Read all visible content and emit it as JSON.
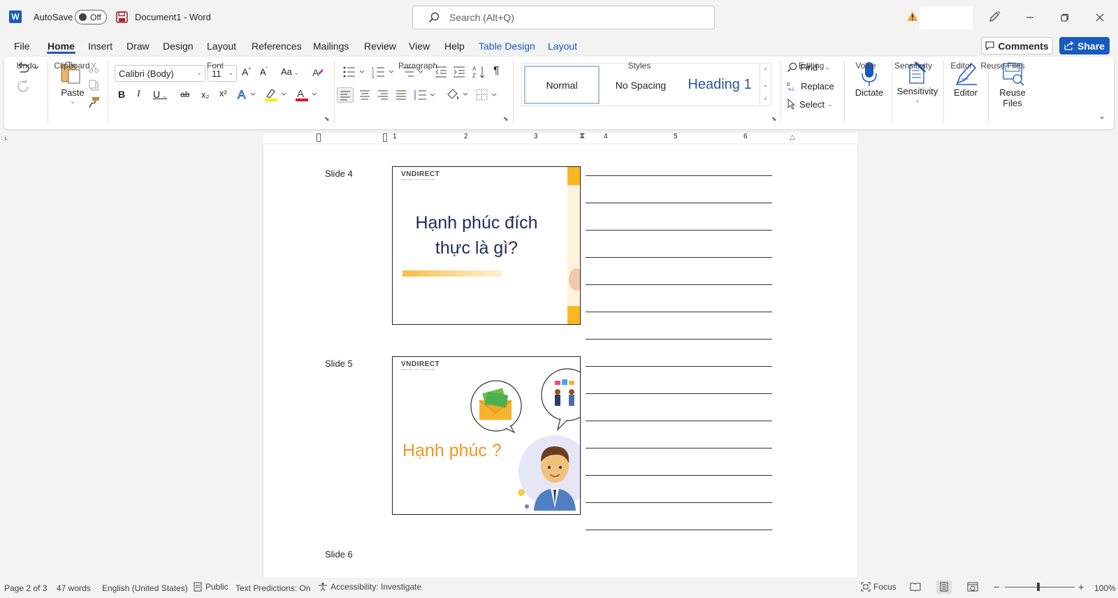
{
  "titlebar": {
    "app_icon_letter": "W",
    "autosave_label": "AutoSave",
    "autosave_state": "Off",
    "doc_title": "Document1  -  Word",
    "search_placeholder": "Search (Alt+Q)"
  },
  "menu": {
    "tabs": [
      "File",
      "Home",
      "Insert",
      "Draw",
      "Design",
      "Layout",
      "References",
      "Mailings",
      "Review",
      "View",
      "Help",
      "Table Design",
      "Layout"
    ],
    "active_tab": "Home",
    "comments_label": "Comments",
    "share_label": "Share"
  },
  "ribbon": {
    "groups": [
      "Undo",
      "Clipboard",
      "Font",
      "Paragraph",
      "Styles",
      "Editing",
      "Voice",
      "Sensitivity",
      "Editor",
      "Reuse Files"
    ],
    "paste_label": "Paste",
    "font_name": "Calibri (Body)",
    "font_size": "11",
    "change_case_label": "Aa",
    "bold": "B",
    "italic": "I",
    "underline": "U",
    "strike": "ab",
    "subscript": "x₂",
    "superscript": "x²",
    "styles": [
      "Normal",
      "No Spacing",
      "Heading 1"
    ],
    "find_label": "Find",
    "replace_label": "Replace",
    "select_label": "Select",
    "dictate_label": "Dictate",
    "sensitivity_label": "Sensitivity",
    "editor_label": "Editor",
    "reuse_files_label": "Reuse Files",
    "reuse_line1": "Reuse",
    "reuse_line2": "Files"
  },
  "ruler": {
    "numbers": [
      "1",
      "1",
      "2",
      "3",
      "4",
      "5",
      "6"
    ]
  },
  "document": {
    "slides": [
      {
        "label": "Slide 4",
        "brand": "VNDIRECT",
        "tagline": "MOVING TO SUCCESS",
        "title_line1": "Hạnh phúc đích",
        "title_line2": "thực là gì?"
      },
      {
        "label": "Slide 5",
        "brand": "VNDIRECT",
        "tagline": "MOVING TO SUCCESS",
        "title": "Hạnh phúc ?"
      },
      {
        "label": "Slide 6"
      }
    ],
    "note_lines": 14
  },
  "status": {
    "page": "Page 2 of 3",
    "words": "47 words",
    "language": "English (United States)",
    "sensitivity": "Public",
    "text_predictions": "Text Predictions: On",
    "accessibility": "Accessibility: Investigate",
    "focus": "Focus",
    "zoom": "100%"
  },
  "colors": {
    "accent": "#185abd",
    "slide_title": "#1f2d5a",
    "slide_orange": "#f7931e",
    "slide_gold": "#fbb724"
  }
}
